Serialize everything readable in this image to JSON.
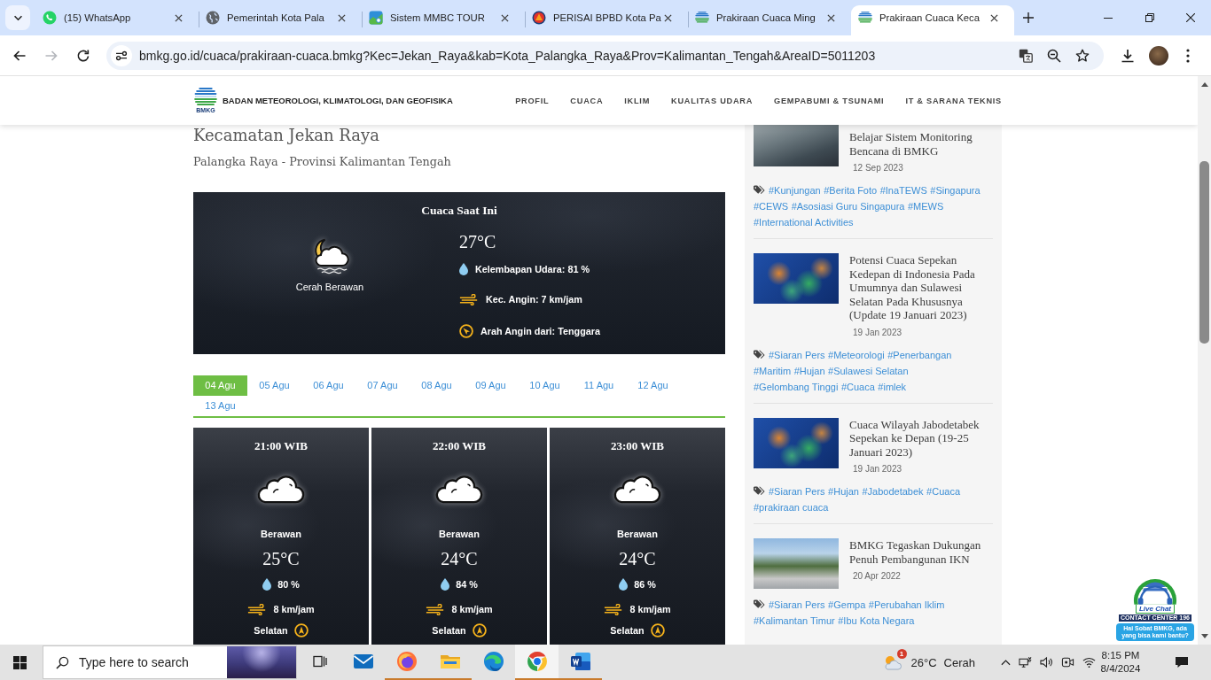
{
  "browser": {
    "tabs": [
      {
        "title": "(15) WhatsApp",
        "kind": "whatsapp",
        "selected": false
      },
      {
        "title": "Pemerintah Kota Pala",
        "kind": "globe",
        "selected": false
      },
      {
        "title": "Sistem MMBC TOUR",
        "kind": "app",
        "selected": false
      },
      {
        "title": "PERISAI BPBD Kota Pa",
        "kind": "shield",
        "selected": false
      },
      {
        "title": "Prakiraan Cuaca Ming",
        "kind": "bmkg",
        "selected": false
      },
      {
        "title": "Prakiraan Cuaca Keca",
        "kind": "bmkg",
        "selected": true
      }
    ],
    "nav_buttons": [
      {
        "kind": "back",
        "disabled": false
      },
      {
        "kind": "forward",
        "disabled": true
      },
      {
        "kind": "reload",
        "disabled": false
      }
    ],
    "url": "bmkg.go.id/cuaca/prakiraan-cuaca.bmkg?Kec=Jekan_Raya&kab=Kota_Palangka_Raya&Prov=Kalimantan_Tengah&AreaID=5011203"
  },
  "site_header": {
    "logo_text": "BMKG",
    "org_name": "BADAN METEOROLOGI, KLIMATOLOGI, DAN GEOFISIKA",
    "nav": [
      "PROFIL",
      "CUACA",
      "IKLIM",
      "KUALITAS UDARA",
      "GEMPABUMI & TSUNAMI",
      "IT & SARANA TEKNIS"
    ]
  },
  "location": {
    "title": "Kecamatan Jekan Raya",
    "subtitle": "Palangka Raya - Provinsi Kalimantan Tengah"
  },
  "current_weather": {
    "heading": "Cuaca Saat Ini",
    "condition": "Cerah Berawan",
    "temperature": "27°C",
    "details": [
      {
        "kind": "humidity",
        "text": "Kelembapan Udara: 81 %"
      },
      {
        "kind": "wind_speed",
        "text": "Kec. Angin: 7 km/jam"
      },
      {
        "kind": "wind_direction",
        "text": "Arah Angin dari: Tenggara"
      }
    ]
  },
  "date_tabs": [
    {
      "label": "04 Agu",
      "selected": true
    },
    {
      "label": "05 Agu",
      "selected": false
    },
    {
      "label": "06 Agu",
      "selected": false
    },
    {
      "label": "07 Agu",
      "selected": false
    },
    {
      "label": "08 Agu",
      "selected": false
    },
    {
      "label": "09 Agu",
      "selected": false
    },
    {
      "label": "10 Agu",
      "selected": false
    },
    {
      "label": "11 Agu",
      "selected": false
    },
    {
      "label": "12 Agu",
      "selected": false
    },
    {
      "label": "13 Agu",
      "selected": false
    }
  ],
  "hourly": [
    {
      "time": "21:00 WIB",
      "condition": "Berawan",
      "temperature": "25°C",
      "humidity": "80 %",
      "wind_speed": "8 km/jam",
      "wind_direction": "Selatan"
    },
    {
      "time": "22:00 WIB",
      "condition": "Berawan",
      "temperature": "24°C",
      "humidity": "84 %",
      "wind_speed": "8 km/jam",
      "wind_direction": "Selatan"
    },
    {
      "time": "23:00 WIB",
      "condition": "Berawan",
      "temperature": "24°C",
      "humidity": "86 %",
      "wind_speed": "8 km/jam",
      "wind_direction": "Selatan"
    }
  ],
  "sidebar_news": [
    {
      "kind": "photo",
      "title": "Belajar Sistem Monitoring Bencana di BMKG",
      "date": "12 Sep 2023",
      "tags": [
        "#Kunjungan",
        "#Berita Foto",
        "#InaTEWS",
        "#Singapura",
        "#CEWS",
        "#Asosiasi Guru Singapura",
        "#MEWS",
        "#International Activities"
      ]
    },
    {
      "kind": "map",
      "title": "Potensi Cuaca Sepekan Kedepan di Indonesia Pada Umumnya dan Sulawesi Selatan Pada Khususnya (Update 19 Januari 2023)",
      "date": "19 Jan 2023",
      "tags": [
        "#Siaran Pers",
        "#Meteorologi",
        "#Penerbangan",
        "#Maritim",
        "#Hujan",
        "#Sulawesi Selatan",
        "#Gelombang Tinggi",
        "#Cuaca",
        "#imlek"
      ]
    },
    {
      "kind": "map",
      "title": "Cuaca Wilayah Jabodetabek Sepekan ke Depan (19-25 Januari 2023)",
      "date": "19 Jan 2023",
      "tags": [
        "#Siaran Pers",
        "#Hujan",
        "#Jabodetabek",
        "#Cuaca",
        "#prakiraan cuaca"
      ]
    },
    {
      "kind": "photo",
      "title": "BMKG Tegaskan Dukungan Penuh Pembangunan IKN",
      "date": "20 Apr 2022",
      "tags": [
        "#Siaran Pers",
        "#Gempa",
        "#Perubahan Iklim",
        "#Kalimantan Timur",
        "#Ibu Kota Negara"
      ]
    }
  ],
  "live_chat": {
    "label": "Live Chat",
    "caption": "CONTACT CENTER 196",
    "bubble": "Hai Sobat BMKG, ada yang bisa kami bantu?"
  },
  "taskbar": {
    "search_placeholder": "Type here to search",
    "apps": [
      {
        "kind": "task_view",
        "running": false,
        "selected": false
      },
      {
        "kind": "mail",
        "running": false,
        "selected": false
      },
      {
        "kind": "firefox",
        "running": true,
        "selected": false
      },
      {
        "kind": "files",
        "running": true,
        "selected": false
      },
      {
        "kind": "edge",
        "running": false,
        "selected": false
      },
      {
        "kind": "chrome",
        "running": true,
        "selected": true
      },
      {
        "kind": "word",
        "running": true,
        "selected": false
      }
    ],
    "weather": {
      "badge": "1",
      "temperature": "26°C",
      "condition": "Cerah"
    },
    "time": "8:15 PM",
    "date": "8/4/2024"
  }
}
